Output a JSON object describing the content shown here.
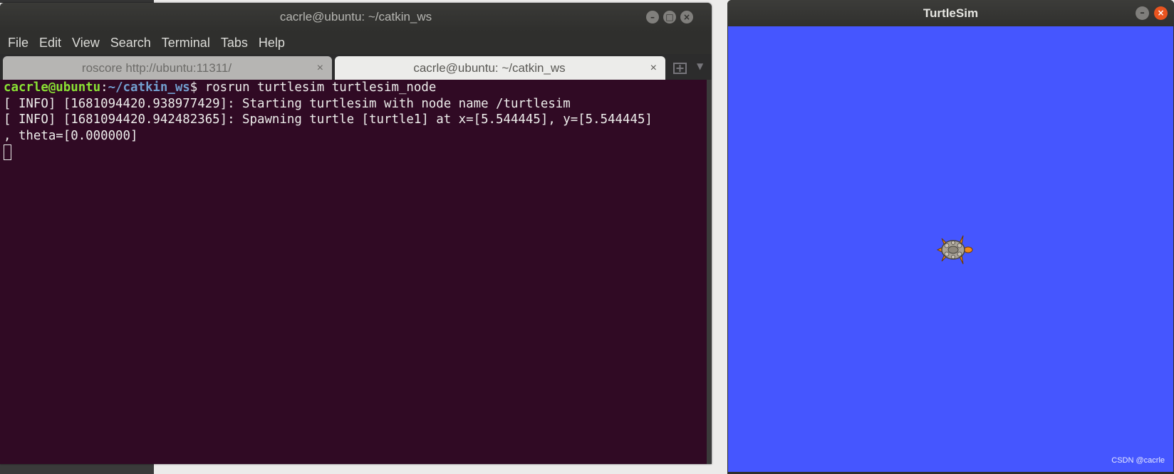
{
  "terminal": {
    "title": "cacrle@ubuntu: ~/catkin_ws",
    "menu": [
      "File",
      "Edit",
      "View",
      "Search",
      "Terminal",
      "Tabs",
      "Help"
    ],
    "tabs": [
      {
        "label": "roscore http://ubuntu:11311/",
        "active": false
      },
      {
        "label": "cacrle@ubuntu: ~/catkin_ws",
        "active": true
      }
    ],
    "prompt_user": "cacrle@ubuntu",
    "prompt_sep": ":",
    "prompt_path": "~/catkin_ws",
    "prompt_symbol": "$ ",
    "command": "rosrun turtlesim turtlesim_node",
    "output": [
      "[ INFO] [1681094420.938977429]: Starting turtlesim with node name /turtlesim",
      "[ INFO] [1681094420.942482365]: Spawning turtle [turtle1] at x=[5.544445], y=[5.544445]",
      ", theta=[0.000000]"
    ],
    "colors": {
      "background": "#300a24",
      "user": "#8ae234",
      "path": "#729fcf",
      "text": "#eeeeec"
    }
  },
  "turtlesim": {
    "title": "TurtleSim",
    "background_color": "#4556ff",
    "turtle_name": "turtle1",
    "watermark": "CSDN @cacrle"
  },
  "icons": {
    "minimize": "minimize-icon",
    "maximize": "maximize-icon",
    "close": "close-icon",
    "new_tab": "new-tab-icon",
    "tab_menu": "chevron-down-icon"
  }
}
